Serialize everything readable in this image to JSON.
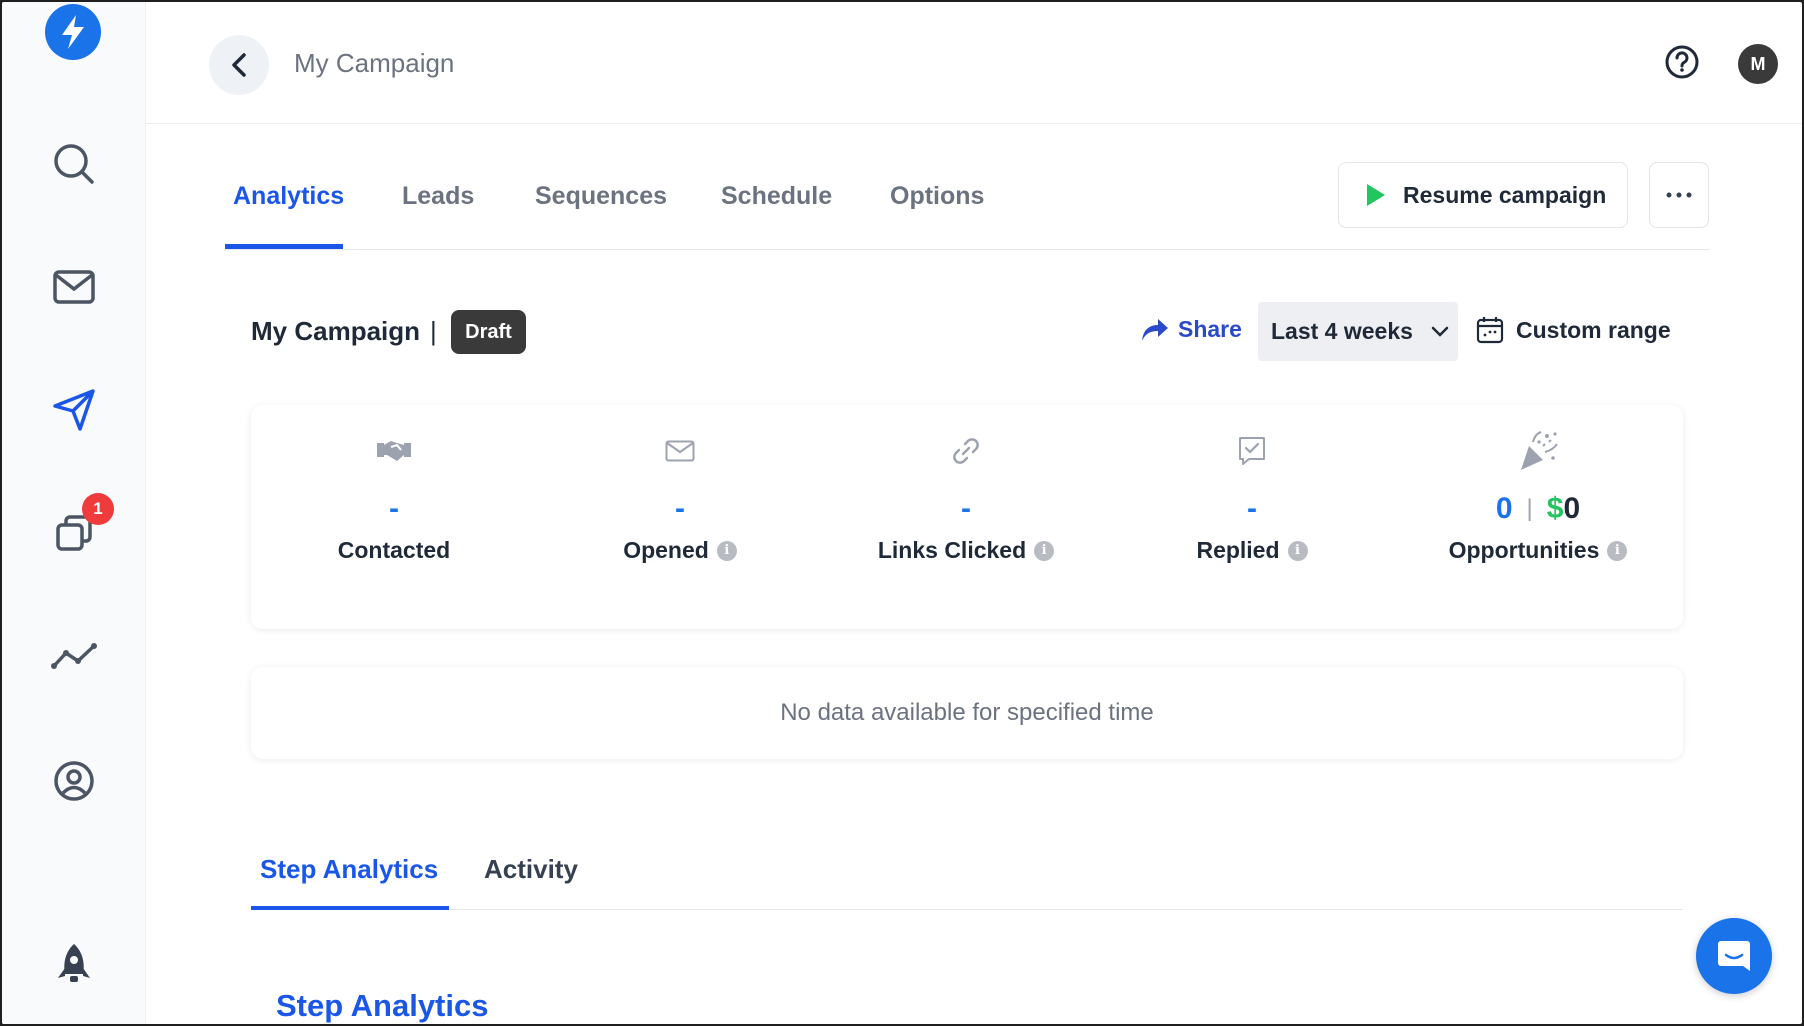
{
  "header": {
    "title": "My Campaign",
    "avatar_initial": "M"
  },
  "sidebar": {
    "items": [
      {
        "icon": "search-icon"
      },
      {
        "icon": "mail-icon"
      },
      {
        "icon": "send-icon"
      },
      {
        "icon": "copy-icon",
        "badge": "1"
      },
      {
        "icon": "analytics-icon"
      },
      {
        "icon": "account-icon"
      },
      {
        "icon": "rocket-icon"
      }
    ]
  },
  "tabs": {
    "items": [
      "Analytics",
      "Leads",
      "Sequences",
      "Schedule",
      "Options"
    ],
    "active": "Analytics",
    "resume_label": "Resume campaign"
  },
  "campaign": {
    "name": "My Campaign",
    "separator": "|",
    "status": "Draft",
    "share_label": "Share",
    "range_value": "Last 4 weeks",
    "custom_range_label": "Custom range"
  },
  "stats": [
    {
      "label": "Contacted",
      "value": "-",
      "icon": "handshake-icon",
      "info": false
    },
    {
      "label": "Opened",
      "value": "-",
      "icon": "envelope-icon",
      "info": true
    },
    {
      "label": "Links Clicked",
      "value": "-",
      "icon": "link-icon",
      "info": true
    },
    {
      "label": "Replied",
      "value": "-",
      "icon": "reply-check-icon",
      "info": true
    },
    {
      "label": "Opportunities",
      "value_count": "0",
      "value_sep": "|",
      "value_currency": "$",
      "value_amount": "0",
      "icon": "party-popper-icon",
      "info": true
    }
  ],
  "empty_message": "No data available for specified time",
  "subtabs": {
    "items": [
      "Step Analytics",
      "Activity"
    ],
    "active": "Step Analytics"
  },
  "section_title": "Step Analytics",
  "colors": {
    "accent": "#1a56e8",
    "brand": "#1a73e8",
    "success": "#22c55e",
    "badge": "#ef3b3b"
  }
}
